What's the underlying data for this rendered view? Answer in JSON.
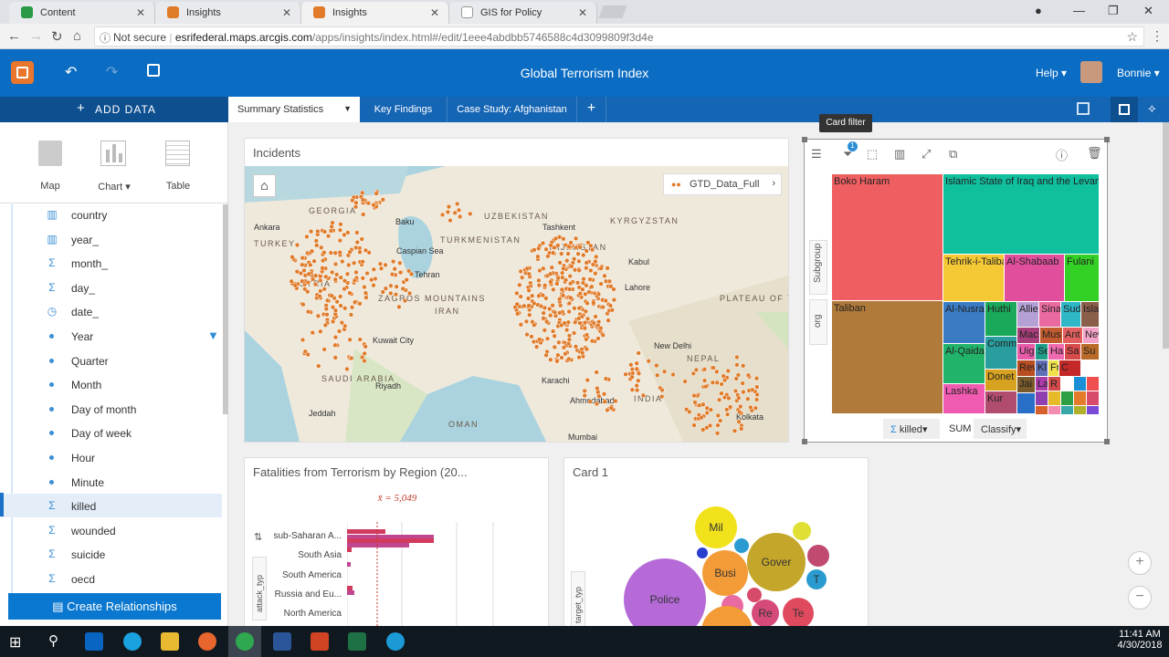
{
  "browser": {
    "tabs": [
      {
        "label": "Content"
      },
      {
        "label": "Insights"
      },
      {
        "label": "Insights"
      },
      {
        "label": "GIS for Policy"
      }
    ],
    "address": {
      "security": "Not secure",
      "host": "esrifederal.maps.arcgis.com",
      "path": "/apps/insights/index.html#/edit/1eee4abdbb5746588c4d3099809f3d4e"
    }
  },
  "app": {
    "title": "Global Terrorism Index",
    "help_label": "Help",
    "user_name": "Bonnie",
    "add_data_label": "ADD DATA"
  },
  "page_tabs": [
    {
      "label": "Summary Statistics"
    },
    {
      "label": "Key Findings"
    },
    {
      "label": "Case Study: Afghanistan"
    }
  ],
  "viz_types": [
    {
      "label": "Map"
    },
    {
      "label": "Chart"
    },
    {
      "label": "Table"
    }
  ],
  "fields": [
    {
      "label": "country",
      "icon": "string-field-icon"
    },
    {
      "label": "year_",
      "icon": "string-field-icon"
    },
    {
      "label": "month_",
      "icon": "number-field-icon"
    },
    {
      "label": "day_",
      "icon": "number-field-icon"
    },
    {
      "label": "date_",
      "icon": "date-field-icon"
    },
    {
      "label": "Year",
      "icon": "date-level-icon"
    },
    {
      "label": "Quarter",
      "icon": "date-level-icon"
    },
    {
      "label": "Month",
      "icon": "date-level-icon"
    },
    {
      "label": "Day of month",
      "icon": "date-level-icon"
    },
    {
      "label": "Day of week",
      "icon": "date-level-icon"
    },
    {
      "label": "Hour",
      "icon": "date-level-icon"
    },
    {
      "label": "Minute",
      "icon": "date-level-icon"
    },
    {
      "label": "killed",
      "icon": "number-field-icon"
    },
    {
      "label": "wounded",
      "icon": "number-field-icon"
    },
    {
      "label": "suicide",
      "icon": "number-field-icon"
    },
    {
      "label": "oecd",
      "icon": "number-field-icon"
    }
  ],
  "create_relationships_label": "Create Relationships",
  "map_card": {
    "title": "Incidents",
    "layer_label": "GTD_Data_Full",
    "places": [
      "GEORGIA",
      "Baku",
      "UZBEKISTAN",
      "Tashkent",
      "KYRGYZSTAN",
      "Ankara",
      "TURKEY",
      "TURKMENISTAN",
      "TAJIKISTAN",
      "Caspian Sea",
      "Tehran",
      "SYRIA",
      "ZAGROS MOUNTAINS",
      "IRAN",
      "PLATEAU OF TIBET",
      "Kuwait City",
      "New Delhi",
      "NEPAL",
      "SAUDI ARABIA",
      "Riyadh",
      "Karachi",
      "Ahmedabad",
      "INDIA",
      "Jeddah",
      "OMAN",
      "Mumbai",
      "Kolkata",
      "Lahore",
      "Kabul"
    ]
  },
  "treemap_card": {
    "tooltip": "Card filter",
    "filter_count": "1",
    "subgroup_label": "Subgroup",
    "org_label": "org",
    "footer": {
      "field": "killed",
      "agg": "SUM",
      "classify": "Classify"
    },
    "groups": [
      "Boko Haram",
      "Islamic State of Iraq and the Levant",
      "Tehrik-i-Taliban",
      "Al-Shabaab",
      "Fulani",
      "Taliban",
      "Al-Nusra",
      "Huthi",
      "Allie",
      "Sina",
      "Sud",
      "Isla",
      "Al-Qaida",
      "Comm",
      "Mac",
      "Mus",
      "Ant",
      "New",
      "Uig",
      "Se",
      "Ha",
      "Sa",
      "Su",
      "Donet",
      "Rev",
      "Kl",
      "Fr",
      "C",
      "Jai",
      "La",
      "R",
      "Lashka",
      "Kur"
    ],
    "colors": {
      "boko": "#ef5f62",
      "isil": "#0fbf9e",
      "taliban": "#b07a3a",
      "ttp": "#f5c935",
      "shabaab": "#e04e9c",
      "fulani": "#33d125"
    }
  },
  "fatalities_card": {
    "title": "Fatalities from Terrorism by Region (20...",
    "mean_label": "x̄ = 5,049",
    "axis_label": "attack_typ",
    "regions": [
      "sub-Saharan A...",
      "South Asia",
      "South America",
      "Russia and Eu...",
      "North America"
    ]
  },
  "bubble_card": {
    "title": "Card 1",
    "axis_label": "target_typ",
    "bubbles": [
      "Mil",
      "Busi",
      "Gover",
      "Police",
      "Te",
      "Re",
      "T"
    ]
  },
  "taskbar": {
    "time": "11:41 AM",
    "date": "4/30/2018"
  }
}
